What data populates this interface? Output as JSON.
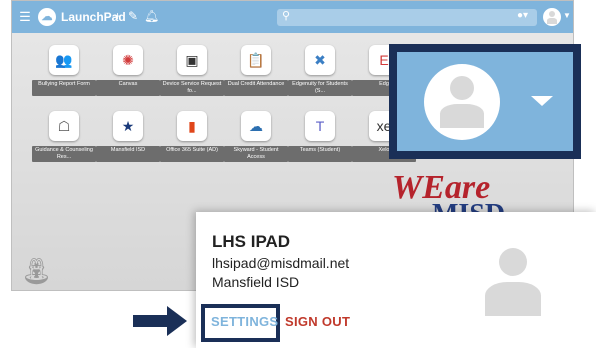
{
  "topbar": {
    "menu_icon": "☰",
    "logo_icon": "cloud-icon",
    "title": "LaunchPad",
    "plus": "+",
    "edit": "✎",
    "bell": "♫"
  },
  "tiles": [
    {
      "label": "Bullying Report Form",
      "icon": "people-icon",
      "glyph": "👥",
      "color": "#2c8ab8"
    },
    {
      "label": "Canvas",
      "icon": "canvas-icon",
      "glyph": "✺",
      "color": "#d23b3b"
    },
    {
      "label": "Device Service Request fo...",
      "icon": "computer-icon",
      "glyph": "▣",
      "color": "#333333"
    },
    {
      "label": "Dual Credit Attendance",
      "icon": "clipboard-icon",
      "glyph": "📋",
      "color": "#e0a030"
    },
    {
      "label": "Edgenuity for Students (S...",
      "icon": "edgenuity-icon",
      "glyph": "✖",
      "color": "#3b7fc4"
    },
    {
      "label": "Edg",
      "icon": "edgenuity-icon",
      "glyph": "E",
      "color": "#d23b3b"
    },
    {
      "label": "Guidance & Counseling Res...",
      "icon": "counselor-icon",
      "glyph": "☖",
      "color": "#555555"
    },
    {
      "label": "Mansfield ISD",
      "icon": "star-icon",
      "glyph": "★",
      "color": "#1a3a7a"
    },
    {
      "label": "Office 365 Suite (AD)",
      "icon": "office-icon",
      "glyph": "▮",
      "color": "#e0461a"
    },
    {
      "label": "Skyward - Student Access",
      "icon": "skyward-icon",
      "glyph": "☁",
      "color": "#2c6fb0"
    },
    {
      "label": "Teams (Student)",
      "icon": "teams-icon",
      "glyph": "T",
      "color": "#5b5fc7"
    },
    {
      "label": "Xelo",
      "icon": "xello-icon",
      "glyph": "xe",
      "color": "#333333"
    }
  ],
  "branding": {
    "line1": "WEare",
    "line2": "MISD"
  },
  "profile": {
    "name": "LHS IPAD",
    "email": "lhsipad@misdmail.net",
    "organization": "Mansfield ISD",
    "settings_label": "SETTINGS",
    "signout_label": "SIGN OUT"
  },
  "colors": {
    "accent": "#7fb4dc",
    "highlight_frame": "#1a2f57",
    "signout": "#c0392b"
  }
}
